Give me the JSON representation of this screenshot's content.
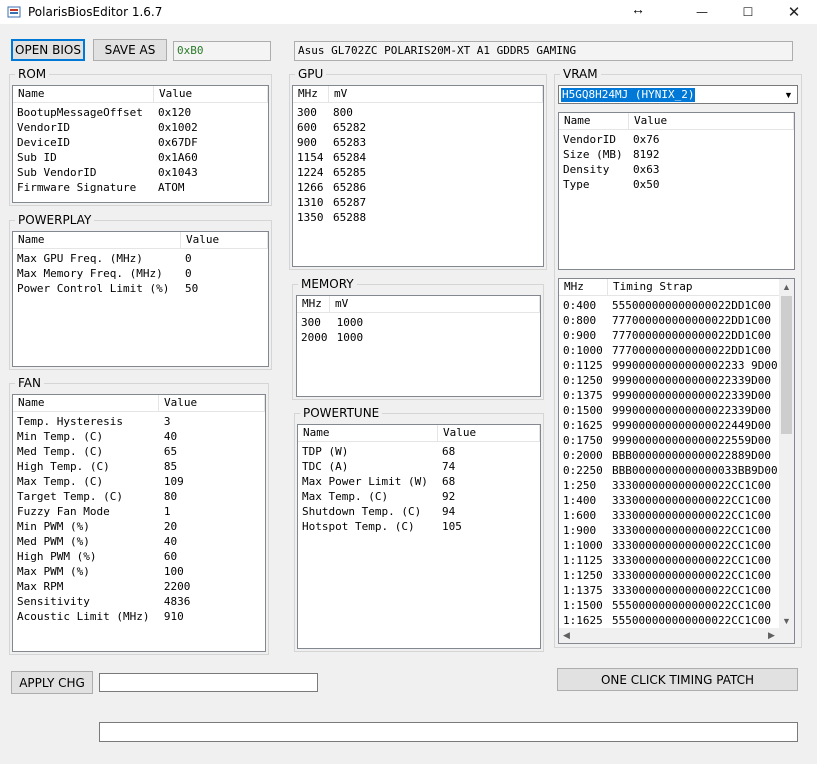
{
  "window": {
    "title": "PolarisBiosEditor 1.6.7"
  },
  "toolbar": {
    "open_bios": "OPEN BIOS",
    "save_as": "SAVE AS",
    "checksum": "0xB0",
    "bios_name": "Asus GL702ZC POLARIS20M-XT A1 GDDR5 GAMING"
  },
  "rom": {
    "title": "ROM",
    "columns": [
      "Name",
      "Value"
    ],
    "rows": [
      [
        "BootupMessageOffset",
        "0x120"
      ],
      [
        "VendorID",
        "0x1002"
      ],
      [
        "DeviceID",
        "0x67DF"
      ],
      [
        "Sub ID",
        "0x1A60"
      ],
      [
        "Sub VendorID",
        "0x1043"
      ],
      [
        "Firmware Signature",
        "ATOM"
      ]
    ]
  },
  "powerplay": {
    "title": "POWERPLAY",
    "columns": [
      "Name",
      "Value"
    ],
    "rows": [
      [
        "Max GPU Freq. (MHz)",
        "0"
      ],
      [
        "Max Memory Freq. (MHz)",
        "0"
      ],
      [
        "Power Control Limit (%)",
        "50"
      ]
    ]
  },
  "fan": {
    "title": "FAN",
    "columns": [
      "Name",
      "Value"
    ],
    "rows": [
      [
        "Temp. Hysteresis",
        "3"
      ],
      [
        "Min Temp. (C)",
        "40"
      ],
      [
        "Med Temp. (C)",
        "65"
      ],
      [
        "High Temp. (C)",
        "85"
      ],
      [
        "Max Temp. (C)",
        "109"
      ],
      [
        "Target Temp. (C)",
        "80"
      ],
      [
        "Fuzzy Fan Mode",
        "1"
      ],
      [
        "Min PWM (%)",
        "20"
      ],
      [
        "Med PWM (%)",
        "40"
      ],
      [
        "High PWM (%)",
        "60"
      ],
      [
        "Max PWM (%)",
        "100"
      ],
      [
        "Max RPM",
        "2200"
      ],
      [
        "Sensitivity",
        "4836"
      ],
      [
        "Acoustic Limit (MHz)",
        "910"
      ]
    ]
  },
  "gpu": {
    "title": "GPU",
    "columns": [
      "MHz",
      "mV"
    ],
    "rows": [
      [
        "300",
        "800"
      ],
      [
        "600",
        "65282"
      ],
      [
        "900",
        "65283"
      ],
      [
        "1154",
        "65284"
      ],
      [
        "1224",
        "65285"
      ],
      [
        "1266",
        "65286"
      ],
      [
        "1310",
        "65287"
      ],
      [
        "1350",
        "65288"
      ]
    ]
  },
  "memory": {
    "title": "MEMORY",
    "columns": [
      "MHz",
      "mV"
    ],
    "rows": [
      [
        "300",
        "1000"
      ],
      [
        "2000",
        "1000"
      ]
    ]
  },
  "powertune": {
    "title": "POWERTUNE",
    "columns": [
      "Name",
      "Value"
    ],
    "rows": [
      [
        "TDP (W)",
        "68"
      ],
      [
        "TDC (A)",
        "74"
      ],
      [
        "Max Power Limit (W)",
        "68"
      ],
      [
        "Max Temp. (C)",
        "92"
      ],
      [
        "Shutdown Temp. (C)",
        "94"
      ],
      [
        "Hotspot Temp. (C)",
        "105"
      ]
    ]
  },
  "vram": {
    "title": "VRAM",
    "selected": "H5GQ8H24MJ (HYNIX_2)",
    "columns": [
      "Name",
      "Value"
    ],
    "rows": [
      [
        "VendorID",
        "0x76"
      ],
      [
        "Size (MB)",
        "8192"
      ],
      [
        "Density",
        "0x63"
      ],
      [
        "Type",
        "0x50"
      ]
    ],
    "timing_columns": [
      "MHz",
      "Timing Strap"
    ],
    "timings": [
      [
        "0:400",
        "555000000000000022DD1C00"
      ],
      [
        "0:800",
        "777000000000000022DD1C00"
      ],
      [
        "0:900",
        "777000000000000022DD1C00"
      ],
      [
        "0:1000",
        "777000000000000022DD1C00"
      ],
      [
        "0:1125",
        "99900000000000002233 9D00"
      ],
      [
        "0:1250",
        "999000000000000022339D00"
      ],
      [
        "0:1375",
        "999000000000000022339D00"
      ],
      [
        "0:1500",
        "999000000000000022339D00"
      ],
      [
        "0:1625",
        "999000000000000022449D00"
      ],
      [
        "0:1750",
        "999000000000000022559D00"
      ],
      [
        "0:2000",
        "BBB000000000000022889D00"
      ],
      [
        "0:2250",
        "BBB0000000000000033BB9D00"
      ],
      [
        "1:250",
        "333000000000000022CC1C00"
      ],
      [
        "1:400",
        "333000000000000022CC1C00"
      ],
      [
        "1:600",
        "333000000000000022CC1C00"
      ],
      [
        "1:900",
        "333000000000000022CC1C00"
      ],
      [
        "1:1000",
        "333000000000000022CC1C00"
      ],
      [
        "1:1125",
        "333000000000000022CC1C00"
      ],
      [
        "1:1250",
        "333000000000000022CC1C00"
      ],
      [
        "1:1375",
        "333000000000000022CC1C00"
      ],
      [
        "1:1500",
        "555000000000000022CC1C00"
      ],
      [
        "1:1625",
        "555000000000000022CC1C00"
      ]
    ]
  },
  "bottom": {
    "apply": "APPLY CHG",
    "timing_patch": "ONE CLICK TIMING PATCH",
    "status": ""
  }
}
